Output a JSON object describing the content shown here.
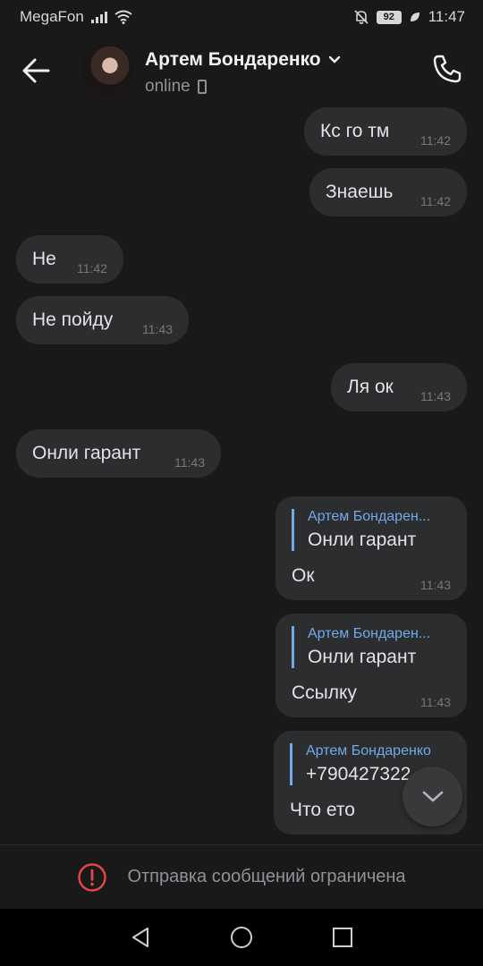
{
  "status_bar": {
    "carrier": "MegaFon",
    "battery": "92",
    "time": "11:47"
  },
  "header": {
    "contact_name": "Артем Бондаренко",
    "contact_status": "online"
  },
  "messages": [
    {
      "side": "out",
      "text": "Кс го тм",
      "time": "11:42"
    },
    {
      "side": "out",
      "text": "Знаешь",
      "time": "11:42"
    },
    {
      "side": "in",
      "text": "Не",
      "time": "11:42"
    },
    {
      "side": "in",
      "text": "Не пойду",
      "time": "11:43"
    },
    {
      "side": "out",
      "text": "Ля ок",
      "time": "11:43"
    },
    {
      "side": "in",
      "text": "Онли гарант",
      "time": "11:43"
    },
    {
      "side": "out",
      "reply_author": "Артем Бондарен...",
      "reply_text": "Онли гарант",
      "text": "Ок",
      "time": "11:43"
    },
    {
      "side": "out",
      "reply_author": "Артем Бондарен...",
      "reply_text": "Онли гарант",
      "text": "Ссылку",
      "time": "11:43"
    },
    {
      "side": "out",
      "reply_author": "Артем Бондаренко",
      "reply_text": "+790427322",
      "text": "Что ето",
      "time": ""
    }
  ],
  "restriction": {
    "text": "Отправка сообщений ограничена"
  },
  "colors": {
    "background": "#19191a",
    "bubble": "#2c2d2e",
    "accent": "#71aaeb",
    "warning": "#e64646"
  }
}
